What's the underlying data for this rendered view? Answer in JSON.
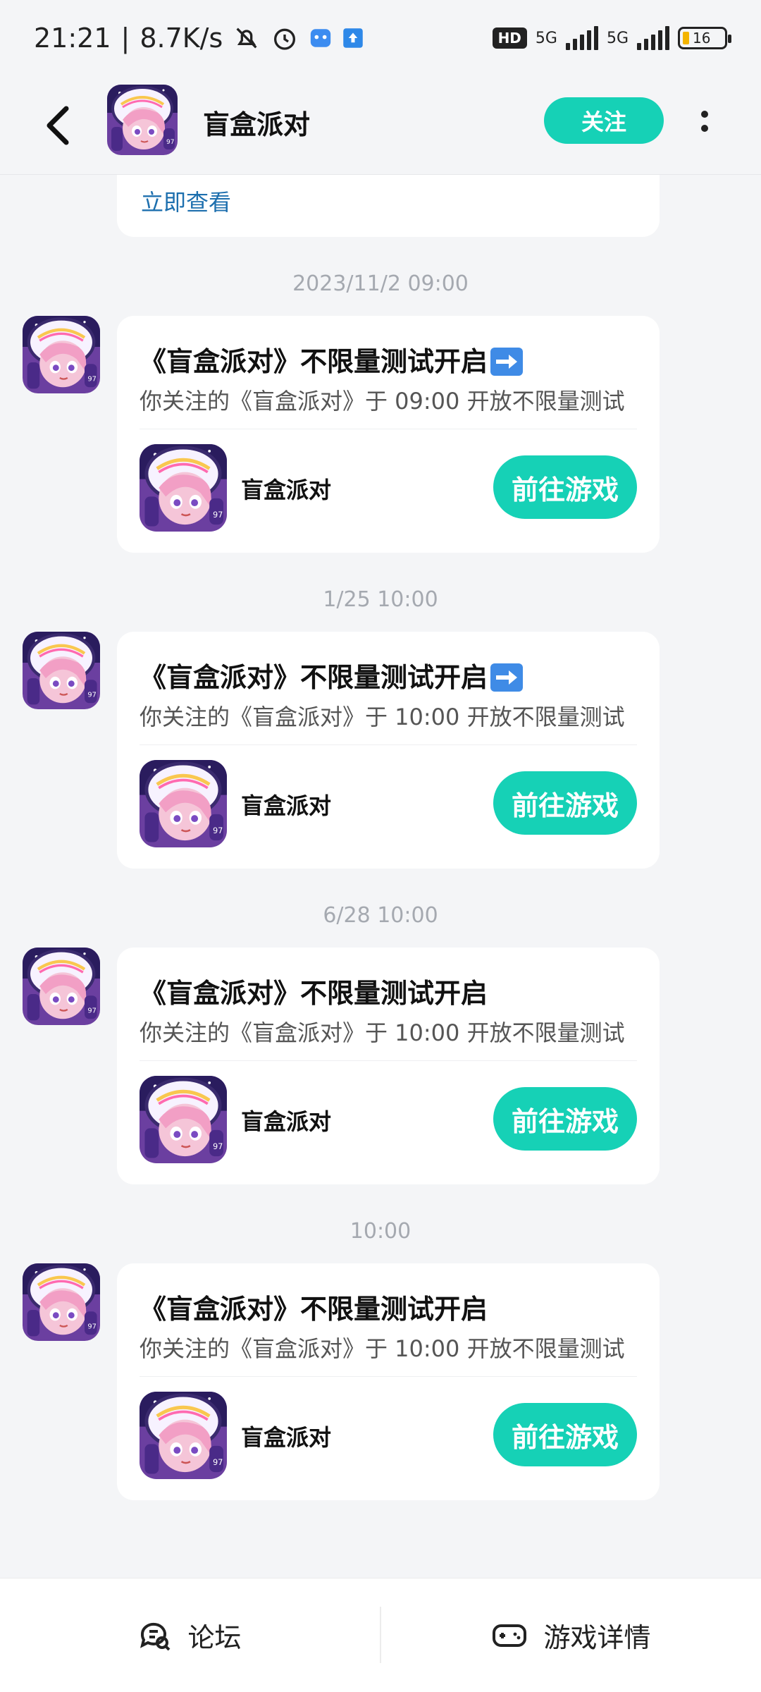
{
  "status_bar": {
    "time": "21:21",
    "net_speed": "8.7K/s",
    "hd": "HD",
    "net1": "5G",
    "net2": "5G",
    "battery": "16"
  },
  "header": {
    "title": "盲盒派对",
    "follow_label": "关注"
  },
  "top_card": {
    "link_text": "立即查看"
  },
  "messages": [
    {
      "time": "2023/11/2  09:00",
      "title": "《盲盒派对》不限量测试开启",
      "has_arrow_emoji": true,
      "desc": "你关注的《盲盒派对》于 09:00 开放不限量测试",
      "game_name": "盲盒派对",
      "button_label": "前往游戏"
    },
    {
      "time": "1/25  10:00",
      "title": "《盲盒派对》不限量测试开启",
      "has_arrow_emoji": true,
      "desc": "你关注的《盲盒派对》于 10:00 开放不限量测试",
      "game_name": "盲盒派对",
      "button_label": "前往游戏"
    },
    {
      "time": "6/28  10:00",
      "title": "《盲盒派对》不限量测试开启",
      "has_arrow_emoji": false,
      "desc": "你关注的《盲盒派对》于 10:00 开放不限量测试",
      "game_name": "盲盒派对",
      "button_label": "前往游戏"
    },
    {
      "time": "10:00",
      "title": "《盲盒派对》不限量测试开启",
      "has_arrow_emoji": false,
      "desc": "你关注的《盲盒派对》于 10:00 开放不限量测试",
      "game_name": "盲盒派对",
      "button_label": "前往游戏"
    }
  ],
  "bottom_bar": {
    "forum_label": "论坛",
    "details_label": "游戏详情"
  },
  "colors": {
    "accent": "#16d1b6",
    "link": "#1d6fae",
    "background": "#f4f5f7"
  }
}
